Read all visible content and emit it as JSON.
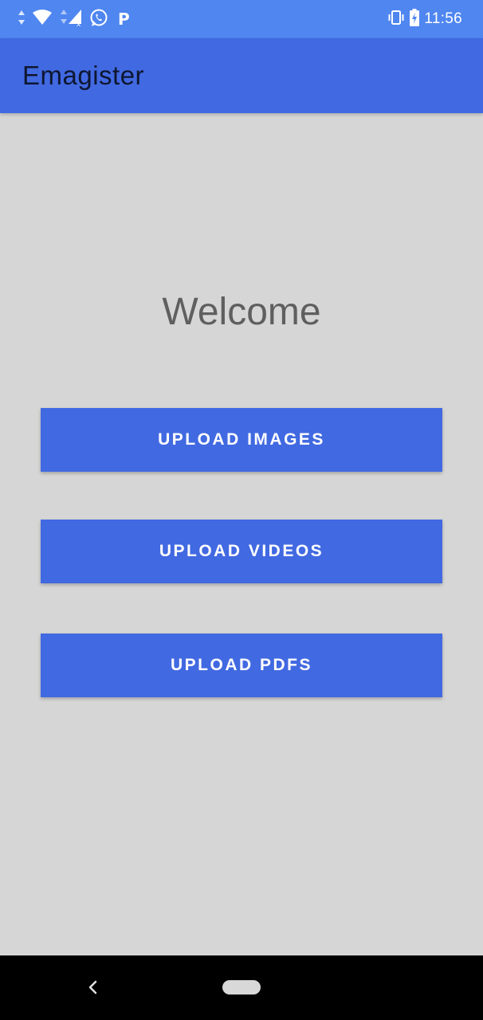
{
  "status_bar": {
    "time": "11:56",
    "icons_left": [
      "data-arrows-icon",
      "wifi-icon",
      "signal-icon",
      "whatsapp-icon",
      "p-app-icon"
    ],
    "icons_right": [
      "vibrate-icon",
      "battery-charging-icon"
    ],
    "p_app_glyph": "P"
  },
  "app_bar": {
    "title": "Emagister",
    "color": "#4169e1"
  },
  "main": {
    "welcome": "Welcome",
    "buttons": [
      {
        "label": "UPLOAD IMAGES"
      },
      {
        "label": "UPLOAD VIDEOS"
      },
      {
        "label": "UPLOAD PDFS"
      }
    ]
  },
  "nav_bar": {
    "icons": [
      "back-icon",
      "home-pill-icon"
    ]
  },
  "colors": {
    "status_bar": "#4f86f0",
    "accent": "#4169e1",
    "background": "#d6d6d6",
    "welcome_text": "#5f5f5f"
  }
}
